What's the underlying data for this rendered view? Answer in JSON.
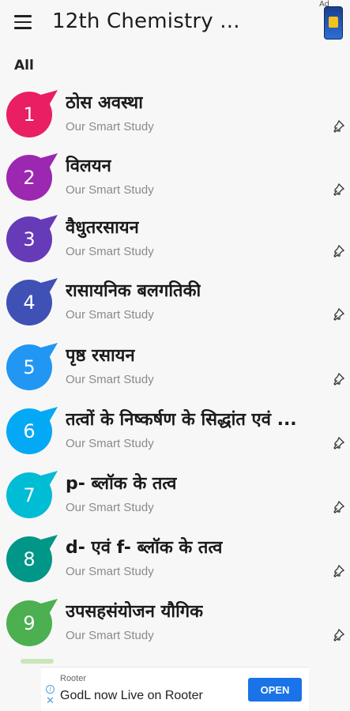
{
  "appbar": {
    "title": "12th Chemistry ...",
    "ad_label": "Ad"
  },
  "section": {
    "label": "All"
  },
  "items": [
    {
      "number": "1",
      "title": "ठोस अवस्था",
      "subtitle": "Our Smart Study",
      "color": "#e91e63"
    },
    {
      "number": "2",
      "title": "विलयन",
      "subtitle": "Our Smart Study",
      "color": "#9c27b0"
    },
    {
      "number": "3",
      "title": "वैधुतरसायन",
      "subtitle": "Our Smart Study",
      "color": "#673ab7"
    },
    {
      "number": "4",
      "title": "रासायनिक बलगतिकी",
      "subtitle": "Our Smart Study",
      "color": "#3f51b5"
    },
    {
      "number": "5",
      "title": "पृष्ठ रसायन",
      "subtitle": "Our Smart Study",
      "color": "#2196f3"
    },
    {
      "number": "6",
      "title": "तत्वों के निष्कर्षण के सिद्धांत एवं ...",
      "subtitle": "Our Smart Study",
      "color": "#03a9f4"
    },
    {
      "number": "7",
      "title": "p- ब्लॉक के तत्व",
      "subtitle": "Our Smart Study",
      "color": "#00bcd4"
    },
    {
      "number": "8",
      "title": "d- एवं f- ब्लॉक के तत्व",
      "subtitle": "Our Smart Study",
      "color": "#009688"
    },
    {
      "number": "9",
      "title": "उपसहसंयोजन यौगिक",
      "subtitle": "Our Smart Study",
      "color": "#4caf50"
    }
  ],
  "ad_banner": {
    "source": "Rooter",
    "text": "GodL now Live on Rooter",
    "button": "OPEN"
  }
}
